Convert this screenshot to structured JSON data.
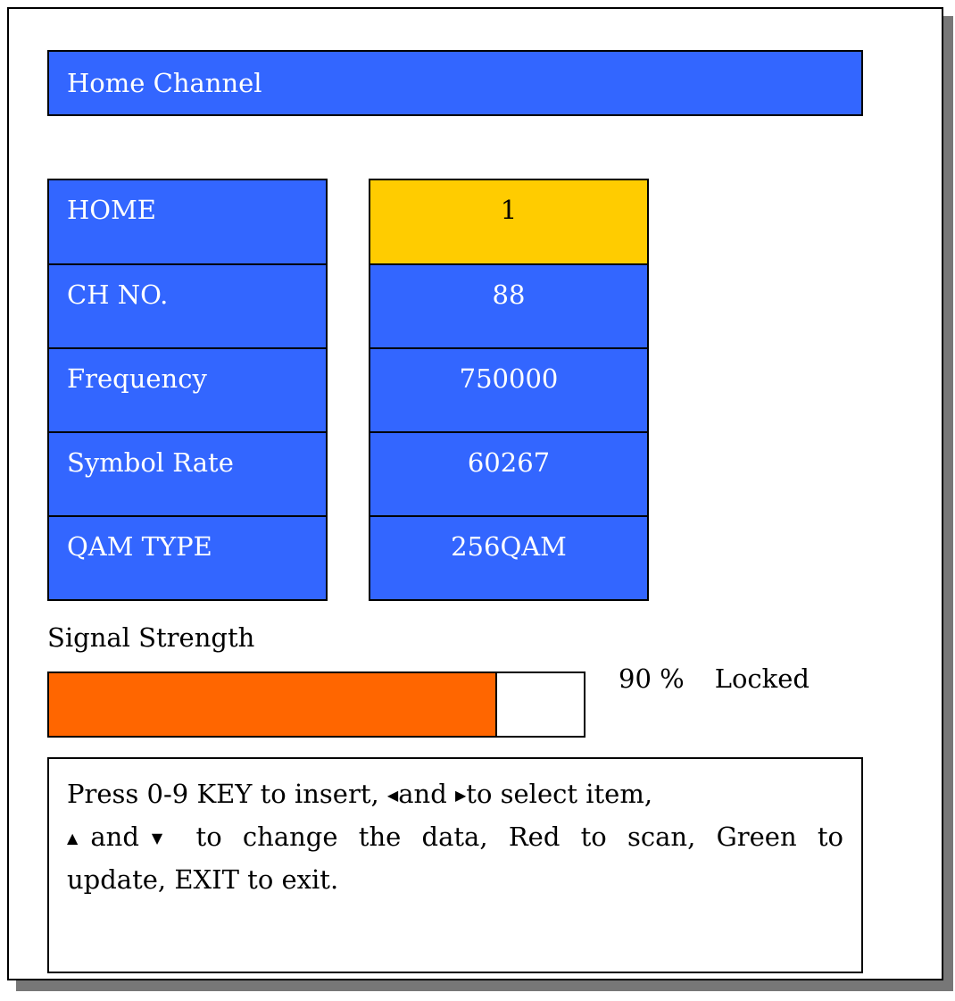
{
  "window": {
    "title": "Home Channel"
  },
  "settings": {
    "labels": [
      "HOME",
      "CH NO.",
      "Frequency",
      "Symbol Rate",
      "QAM TYPE"
    ],
    "values": [
      "1",
      "88",
      "750000",
      "60267",
      "256QAM"
    ],
    "selected_index": 0
  },
  "signal": {
    "label": "Signal Strength",
    "percent": 90,
    "percent_text": "90 %",
    "status": "Locked"
  },
  "help": {
    "line1_a": "Press 0-9 KEY to insert,",
    "line1_b": "and",
    "line1_c": "to select item,",
    "line2_a": "and",
    "line2_b": "to change the data, Red to scan, Green to",
    "line3": "update, EXIT to exit."
  },
  "colors": {
    "panel_blue": "#3366ff",
    "selected_yellow": "#ffcc00",
    "signal_orange": "#ff6600"
  },
  "icons": {
    "left": "left-arrow-icon",
    "right": "right-arrow-icon",
    "up": "up-arrow-icon",
    "down": "down-arrow-icon"
  }
}
